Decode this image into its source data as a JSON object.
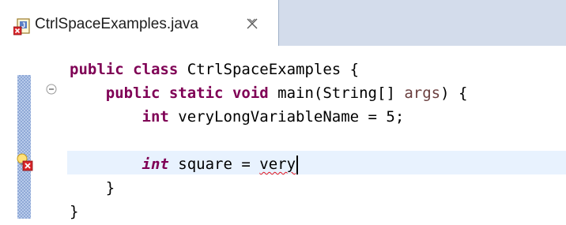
{
  "tab": {
    "title": "CtrlSpaceExamples.java",
    "icon": "java-file-error-icon",
    "close_icon": "close-icon"
  },
  "editor": {
    "lines": {
      "l1": {
        "kw1": "public",
        "kw2": "class",
        "name": "CtrlSpaceExamples",
        "brace": "{"
      },
      "l2": {
        "kw1": "public",
        "kw2": "static",
        "kw3": "void",
        "name": "main(String[]",
        "param": "args",
        "tail": ") {"
      },
      "l3": {
        "kw": "int",
        "name": "veryLongVariableName",
        "tail": "= 5;"
      },
      "l4": {
        "text": ""
      },
      "l5": {
        "kw": "int",
        "name": "square",
        "op": "=",
        "typed": "very"
      },
      "l6": {
        "text": "}"
      },
      "l7": {
        "text": "}"
      }
    },
    "gutter": {
      "fold_icon": "collapse-icon",
      "marker_icon": "quick-fix-error-icon"
    },
    "colors": {
      "keyword": "#7f0055",
      "parameter": "#6a3e3e",
      "current_line": "#e8f2fe",
      "error_underline": "#e0141e",
      "tab_bar": "#d3dceb"
    }
  }
}
